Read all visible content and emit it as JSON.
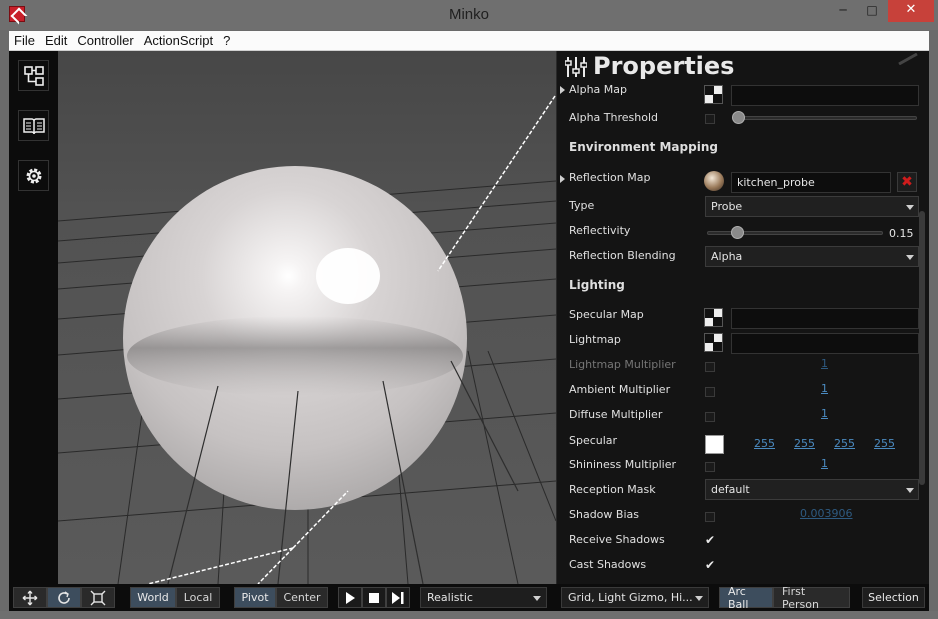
{
  "window": {
    "title": "Minko",
    "minimize": "─",
    "maximize": "□",
    "close": "✕"
  },
  "menu": [
    "File",
    "Edit",
    "Controller",
    "ActionScript",
    "?"
  ],
  "left_toolbar": [
    {
      "icon": "scene-graph-icon"
    },
    {
      "icon": "library-icon"
    },
    {
      "icon": "gear-icon"
    }
  ],
  "panel": {
    "title": "Properties",
    "rows": {
      "alpha_map": "Alpha Map",
      "alpha_threshold": "Alpha Threshold",
      "env_section": "Environment Mapping",
      "reflection_map": "Reflection Map",
      "reflection_map_value": "kitchen_probe",
      "type": "Type",
      "type_value": "Probe",
      "reflectivity": "Reflectivity",
      "reflectivity_value": "0.15",
      "reflection_blending": "Reflection Blending",
      "reflection_blending_value": "Alpha",
      "lighting_section": "Lighting",
      "specular_map": "Specular Map",
      "lightmap": "Lightmap",
      "lightmap_multiplier": "Lightmap Multiplier",
      "lightmap_multiplier_value": "1",
      "ambient_multiplier": "Ambient Multiplier",
      "ambient_multiplier_value": "1",
      "diffuse_multiplier": "Diffuse Multiplier",
      "diffuse_multiplier_value": "1",
      "specular": "Specular",
      "specular_r": "255",
      "specular_g": "255",
      "specular_b": "255",
      "specular_a": "255",
      "shininess_multiplier": "Shininess Multiplier",
      "shininess_multiplier_value": "1",
      "reception_mask": "Reception Mask",
      "reception_mask_value": "default",
      "shadow_bias": "Shadow Bias",
      "shadow_bias_value": "0.003906",
      "receive_shadows": "Receive Shadows",
      "cast_shadows": "Cast Shadows"
    },
    "alpha_threshold_level": 0.0,
    "reflectivity_level": 0.15,
    "receive_shadows_checked": true,
    "cast_shadows_checked": true
  },
  "bottom_toolbar": {
    "world": "World",
    "local": "Local",
    "pivot": "Pivot",
    "center": "Center",
    "render_mode": "Realistic",
    "display_options": "Grid, Light Gizmo, Hi...",
    "arc_ball": "Arc Ball",
    "first_person": "First Person",
    "selection": "Selection"
  }
}
